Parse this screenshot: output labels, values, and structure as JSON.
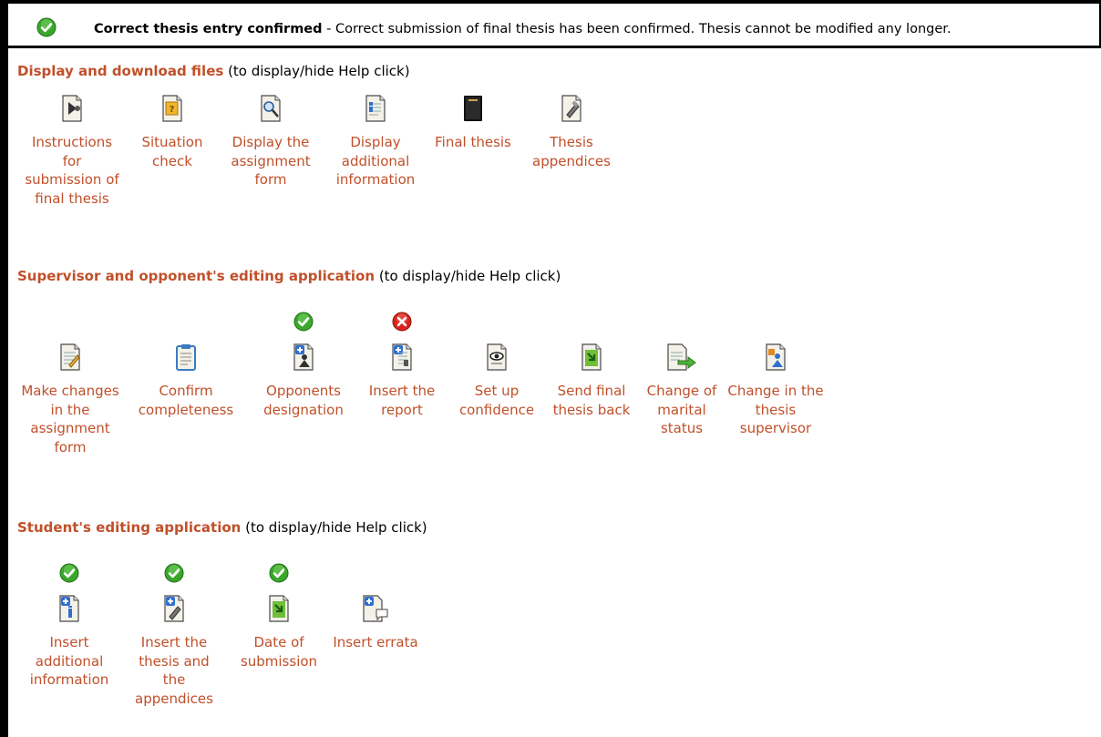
{
  "status": {
    "title": "Correct thesis entry confirmed",
    "message": " - Correct submission of final thesis has been confirmed. Thesis cannot be modified any longer.",
    "icon": "check-circle-icon",
    "color": "#3aa62b"
  },
  "sections": {
    "display": {
      "title": "Display and download files",
      "help": " (to display/hide Help click)"
    },
    "supervisor": {
      "title": "Supervisor and opponent's editing application",
      "help": " (to display/hide Help click)"
    },
    "student": {
      "title": "Student's editing application",
      "help": " (to display/hide Help click)"
    }
  },
  "display_items": [
    {
      "label": "Instructions for submission of final thesis",
      "icon": "instructions-icon"
    },
    {
      "label": "Situation check",
      "icon": "situation-check-icon"
    },
    {
      "label": "Display the assignment form",
      "icon": "magnifier-document-icon"
    },
    {
      "label": "Display additional information",
      "icon": "info-document-icon"
    },
    {
      "label": "Final thesis",
      "icon": "black-book-icon"
    },
    {
      "label": "Thesis appendices",
      "icon": "appendices-icon"
    }
  ],
  "supervisor_items": [
    {
      "label": "Make changes in the assignment form",
      "icon": "edit-document-icon",
      "badge": ""
    },
    {
      "label": "Confirm completeness",
      "icon": "clipboard-icon",
      "badge": ""
    },
    {
      "label": "Opponents designation",
      "icon": "person-document-icon",
      "badge": "check"
    },
    {
      "label": "Insert the report",
      "icon": "insert-report-icon",
      "badge": "cross"
    },
    {
      "label": "Set up confidence",
      "icon": "eye-document-icon",
      "badge": ""
    },
    {
      "label": "Send final thesis back",
      "icon": "send-back-icon",
      "badge": ""
    },
    {
      "label": "Change of marital status",
      "icon": "change-arrow-icon",
      "badge": ""
    },
    {
      "label": "Change in the thesis supervisor",
      "icon": "supervisor-change-icon",
      "badge": ""
    }
  ],
  "student_items": [
    {
      "label": "Insert additional information",
      "icon": "insert-info-icon",
      "badge": "check"
    },
    {
      "label": "Insert the thesis and the appendices",
      "icon": "insert-thesis-icon",
      "badge": "check"
    },
    {
      "label": "Date of submission",
      "icon": "date-submission-icon",
      "badge": "check"
    },
    {
      "label": "Insert errata",
      "icon": "insert-errata-icon",
      "badge": ""
    }
  ],
  "colors": {
    "link": "#c0502a",
    "check": "#3aa62b",
    "cross": "#d9231b"
  }
}
